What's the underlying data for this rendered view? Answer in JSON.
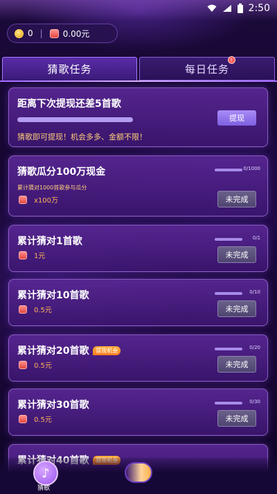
{
  "status_bar": {
    "time": "2:50"
  },
  "balance": {
    "coins": "0",
    "cash": "0.00元"
  },
  "tabs": [
    {
      "label": "猜歌任务"
    },
    {
      "label": "每日任务"
    }
  ],
  "withdraw_card": {
    "title": "距离下次提现还差5首歌",
    "button": "提现",
    "subtitle": "猜歌即可提现！机会多多、金额不限！",
    "progress": 1.0
  },
  "tasks": [
    {
      "title": "猜歌瓜分100万现金",
      "desc": "累计猜对1000首歌参与瓜分",
      "progress_text": "0/1000",
      "reward": "x100万",
      "button": "未完成"
    },
    {
      "title": "累计猜对1首歌",
      "progress_text": "0/1",
      "reward": "1元",
      "button": "未完成"
    },
    {
      "title": "累计猜对10首歌",
      "progress_text": "0/10",
      "reward": "0.5元",
      "button": "未完成"
    },
    {
      "title": "累计猜对20首歌",
      "badge": "提现机会",
      "progress_text": "0/20",
      "reward": "0.5元",
      "button": "未完成"
    },
    {
      "title": "累计猜对30首歌",
      "progress_text": "0/30",
      "reward": "0.5元",
      "button": "未完成"
    },
    {
      "title": "累计猜对40首歌",
      "badge": "提现机会"
    }
  ],
  "bottom_nav": {
    "guess_label": "猜歌"
  }
}
